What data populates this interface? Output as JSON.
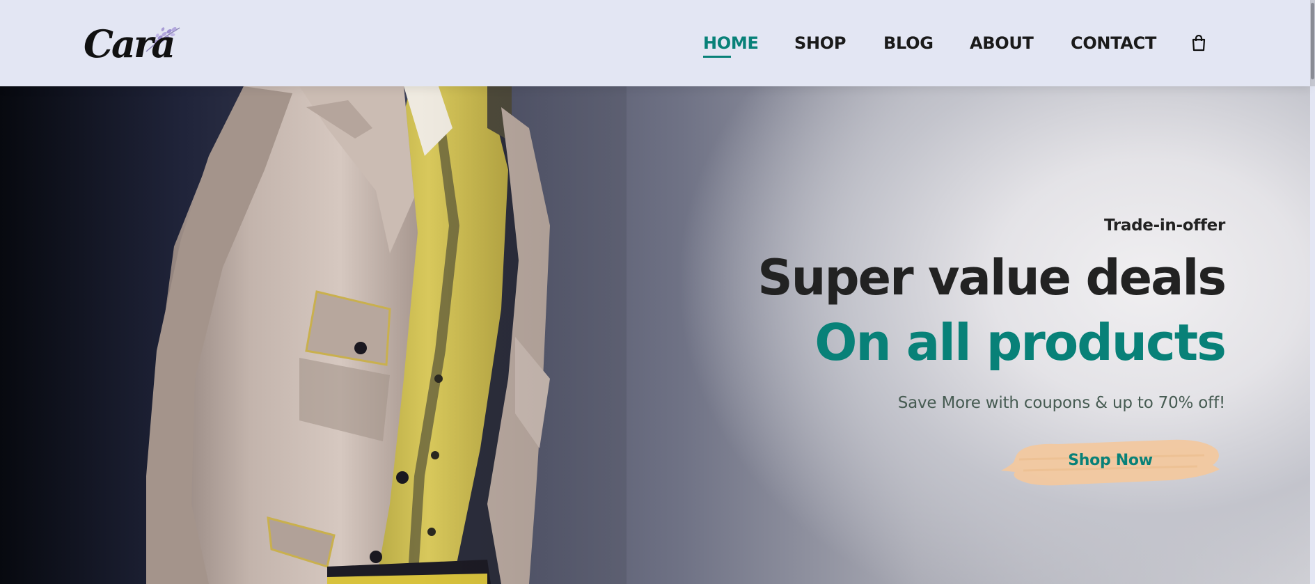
{
  "header": {
    "logo_text": "Cara",
    "nav": [
      {
        "label": "HOME",
        "active": true
      },
      {
        "label": "SHOP",
        "active": false
      },
      {
        "label": "BLOG",
        "active": false
      },
      {
        "label": "ABOUT",
        "active": false
      },
      {
        "label": "CONTACT",
        "active": false
      }
    ],
    "cart_icon": "shopping-bag-icon"
  },
  "hero": {
    "offer": "Trade-in-offer",
    "title_line1": "Super value deals",
    "title_line2": "On all products",
    "subtitle": "Save More with coupons & up to 70% off!",
    "button_label": "Shop Now"
  },
  "colors": {
    "accent": "#088178",
    "header_bg": "#e3e6f3",
    "button_brush": "#f2c89f",
    "text_dark": "#222222"
  }
}
